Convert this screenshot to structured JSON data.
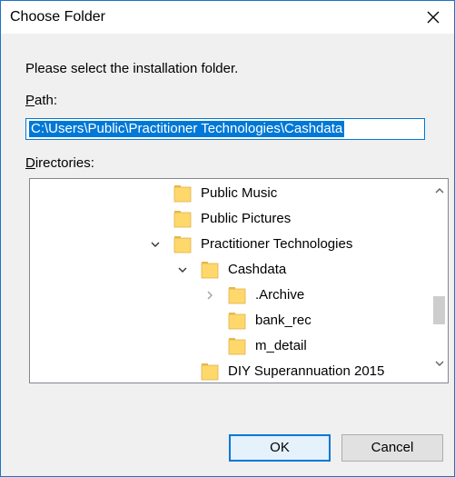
{
  "dialog": {
    "title": "Choose Folder",
    "close_glyph": "✕",
    "instruction": "Please select the installation folder."
  },
  "path": {
    "label_accel": "P",
    "label_rest": "ath:",
    "value": "C:\\Users\\Public\\Practitioner Technologies\\Cashdata"
  },
  "directories": {
    "label_accel": "D",
    "label_rest": "irectories:",
    "items": [
      {
        "label": "Public Music",
        "expander": "none",
        "icon": "folder-icon",
        "level": 0
      },
      {
        "label": "Public Pictures",
        "expander": "none",
        "icon": "folder-icon",
        "level": 0
      },
      {
        "label": "Practitioner Technologies",
        "expander": "expanded",
        "icon": "folder-icon",
        "level": 0
      },
      {
        "label": "Cashdata",
        "expander": "expanded",
        "icon": "folder-icon",
        "level": 1
      },
      {
        "label": ".Archive",
        "expander": "collapsed",
        "icon": "folder-icon",
        "level": 2
      },
      {
        "label": "bank_rec",
        "expander": "none",
        "icon": "folder-icon",
        "level": 2
      },
      {
        "label": "m_detail",
        "expander": "none",
        "icon": "folder-icon",
        "level": 2
      },
      {
        "label": "DIY Superannuation 2015",
        "expander": "none",
        "icon": "folder-icon",
        "level": 1
      }
    ],
    "scrollbar": {
      "up_icon": "chevron-up-icon",
      "down_icon": "chevron-down-icon"
    }
  },
  "buttons": {
    "ok": "OK",
    "cancel": "Cancel"
  },
  "colors": {
    "accent": "#0078d7",
    "folder": "#ffd86b",
    "dialog_bg": "#f0f0f0",
    "border": "#1e73c4"
  }
}
